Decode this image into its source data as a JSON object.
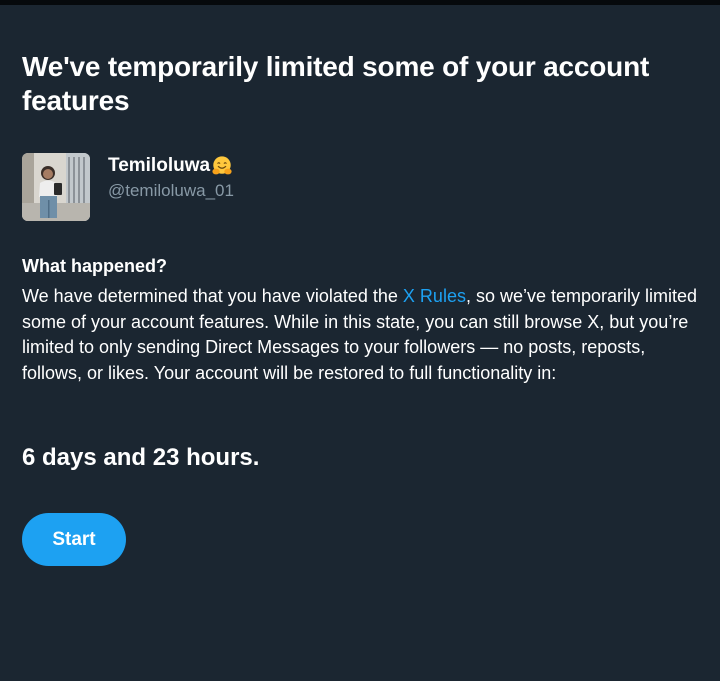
{
  "header": {
    "title": "We've temporarily limited some of your account features"
  },
  "account": {
    "display_name": "Temiloluwa",
    "emoji_icon": "hugging-face-emoji",
    "handle": "@temiloluwa_01",
    "avatar_icon": "profile-photo"
  },
  "info": {
    "heading": "What happened?",
    "text_before_link": "We have determined that you have violated the ",
    "link_label": "X Rules",
    "text_after_link": ", so we’ve temporarily limited some of your account features. While in this state, you can still browse X, but you’re limited to only sending Direct Messages to your followers — no posts, reposts, follows, or likes. Your account will be restored to full functionality in:"
  },
  "duration": "6 days and 23 hours.",
  "actions": {
    "start_label": "Start"
  },
  "colors": {
    "background": "#1b2631",
    "accent": "#1da1f2",
    "secondary_text": "#8899a6",
    "primary_text": "#ffffff"
  }
}
